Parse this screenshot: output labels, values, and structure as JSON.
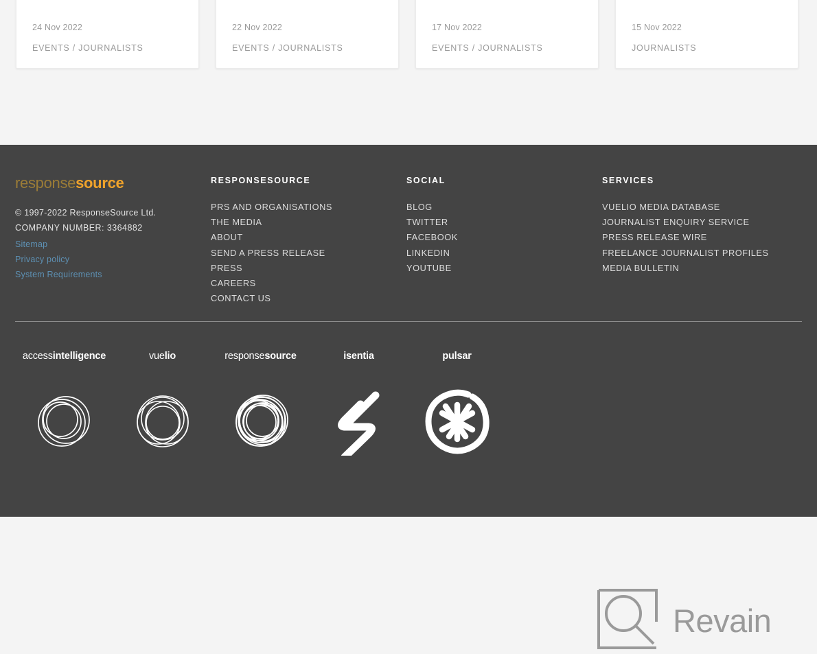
{
  "cards": [
    {
      "date": "24 Nov 2022",
      "categories": "EVENTS / JOURNALISTS"
    },
    {
      "date": "22 Nov 2022",
      "categories": "EVENTS / JOURNALISTS"
    },
    {
      "date": "17 Nov 2022",
      "categories": "EVENTS / JOURNALISTS"
    },
    {
      "date": "15 Nov 2022",
      "categories": "JOURNALISTS"
    }
  ],
  "footer": {
    "brand": {
      "logo_part1": "response",
      "logo_part2": "source",
      "copyright": "© 1997-2022 ResponseSource Ltd.",
      "company_number": "COMPANY NUMBER: 3364882",
      "links": [
        "Sitemap",
        "Privacy policy",
        "System Requirements"
      ]
    },
    "columns": [
      {
        "heading": "RESPONSESOURCE",
        "links": [
          "PRS AND ORGANISATIONS",
          "THE MEDIA",
          "ABOUT",
          "SEND A PRESS RELEASE",
          "PRESS",
          "CAREERS",
          "CONTACT US"
        ]
      },
      {
        "heading": "SOCIAL",
        "links": [
          "BLOG",
          "TWITTER",
          "FACEBOOK",
          "LINKEDIN",
          "YOUTUBE"
        ]
      },
      {
        "heading": "SERVICES",
        "links": [
          "VUELIO MEDIA DATABASE",
          "JOURNALIST ENQUIRY SERVICE",
          "PRESS RELEASE WIRE",
          "FREELANCE JOURNALIST PROFILES",
          "MEDIA BULLETIN"
        ]
      }
    ],
    "brands": [
      {
        "light": "access",
        "bold": "intelligence",
        "mark": "interlocked-circles-logo"
      },
      {
        "light": "vue",
        "bold": "lio",
        "mark": "overlapping-circles-logo"
      },
      {
        "light": "response",
        "bold": "source",
        "mark": "spiral-circles-logo"
      },
      {
        "light": "",
        "bold": "isentia",
        "mark": "isentia-s-logo"
      },
      {
        "light": "",
        "bold": "pulsar",
        "mark": "pulsar-asterisk-logo"
      }
    ]
  },
  "watermark": {
    "text": "Revain",
    "icon": "revain-logo"
  },
  "colors": {
    "footer_bg": "#444444",
    "page_bg": "#f4f4f4",
    "card_bg": "#ffffff",
    "brand_orange": "#f0a32b",
    "brand_gold": "#9b7c37",
    "link_blue": "#5d90b3",
    "muted_text": "#9a9a9a",
    "watermark_gray": "#9a9a9a"
  }
}
